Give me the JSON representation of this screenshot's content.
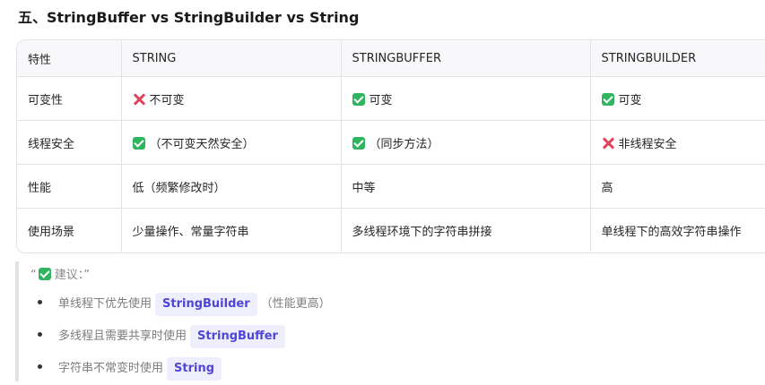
{
  "heading": "五、StringBuffer vs StringBuilder vs String",
  "table": {
    "headers": [
      "特性",
      "STRING",
      "STRINGBUFFER",
      "STRINGBUILDER"
    ],
    "rows": [
      {
        "feature": "可变性",
        "string": {
          "icon": "cross-icon",
          "text": "不可变"
        },
        "buffer": {
          "icon": "check-icon",
          "text": "可变"
        },
        "builder": {
          "icon": "check-icon",
          "text": "可变"
        }
      },
      {
        "feature": "线程安全",
        "string": {
          "icon": "check-icon",
          "text": "（不可变天然安全）"
        },
        "buffer": {
          "icon": "check-icon",
          "text": "（同步方法）"
        },
        "builder": {
          "icon": "cross-icon",
          "text": "非线程安全"
        }
      },
      {
        "feature": "性能",
        "string": {
          "text": "低（频繁修改时）"
        },
        "buffer": {
          "text": "中等"
        },
        "builder": {
          "text": "高"
        }
      },
      {
        "feature": "使用场景",
        "string": {
          "text": "少量操作、常量字符串"
        },
        "buffer": {
          "text": "多线程环境下的字符串拼接"
        },
        "builder": {
          "text": "单线程下的高效字符串操作"
        }
      }
    ]
  },
  "quote": {
    "open_quote": "“",
    "icon": "check-icon",
    "title": "建议：",
    "close_quote": "”",
    "items": [
      {
        "before": "单线程下优先使用",
        "code": "StringBuilder",
        "after": "（性能更高）"
      },
      {
        "before": "多线程且需要共享时使用",
        "code": "StringBuffer",
        "after": ""
      },
      {
        "before": "字符串不常变时使用",
        "code": "String",
        "after": ""
      }
    ]
  },
  "colors": {
    "check": "#2fb45f",
    "cross": "#e2445c",
    "code_text": "#4f46d6",
    "code_bg": "#eeeefc"
  }
}
